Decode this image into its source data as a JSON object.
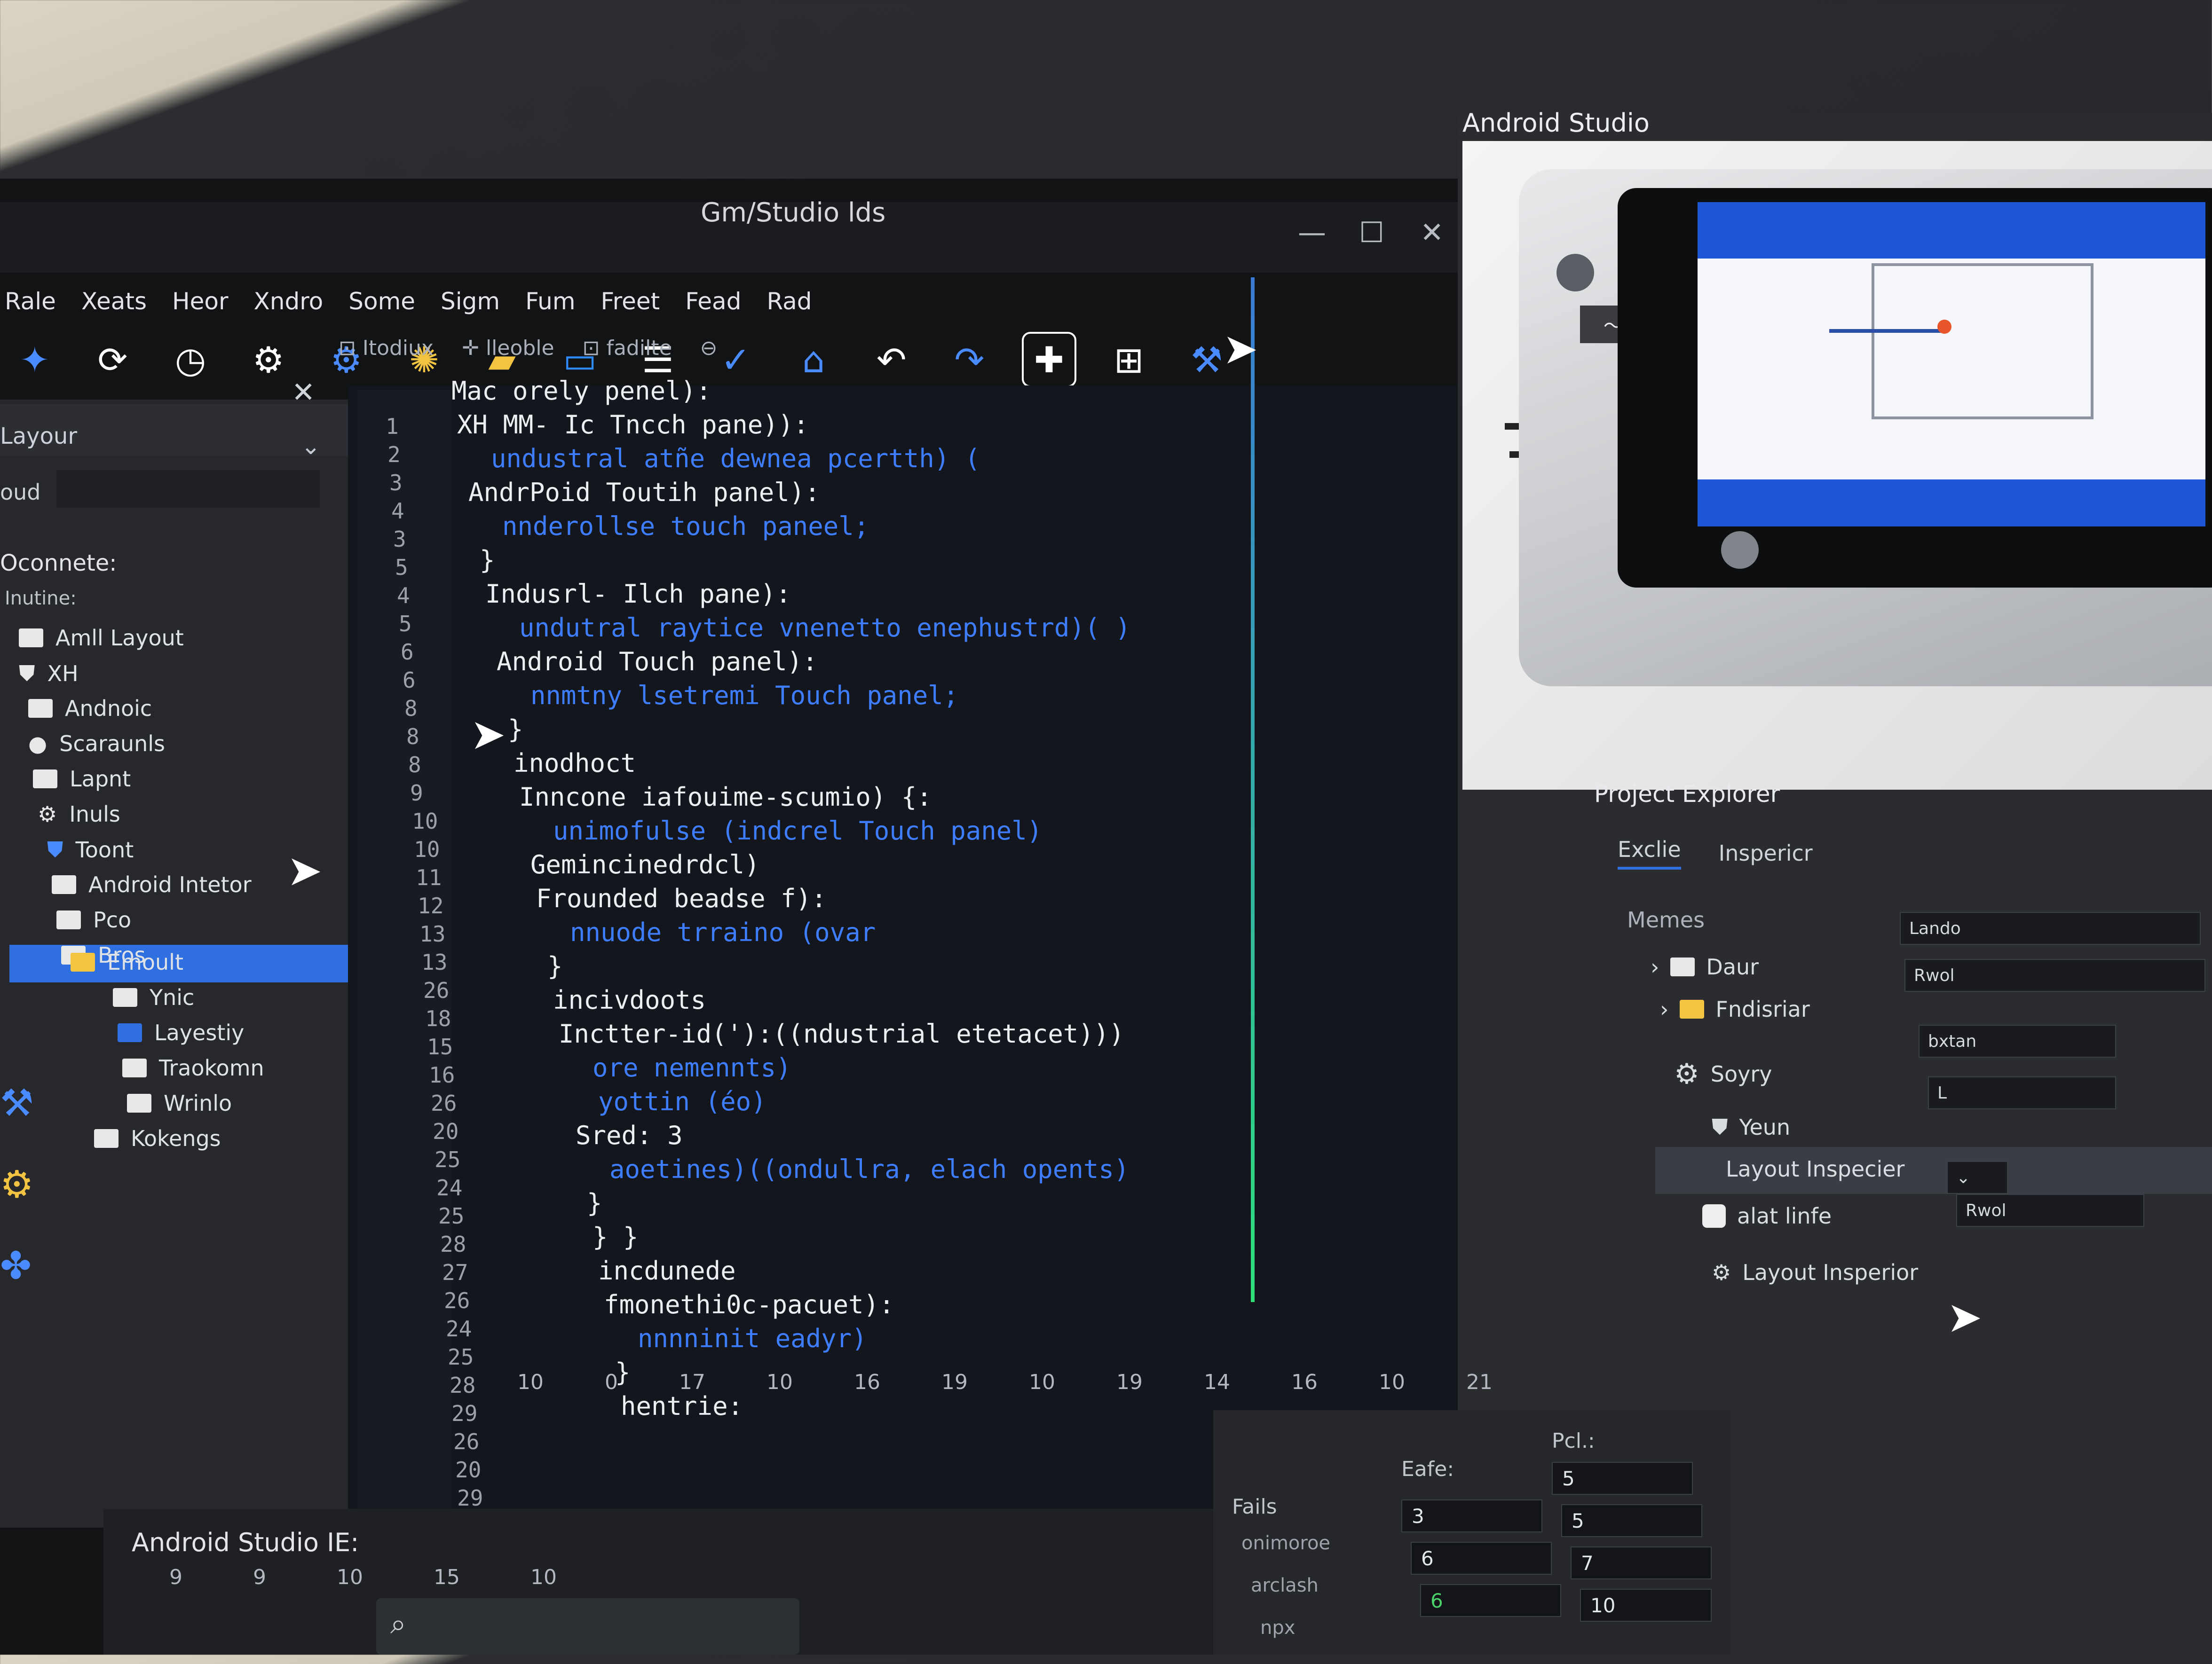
{
  "window": {
    "title": "Gm/Studio  lds",
    "controls": [
      "—",
      "☐",
      "✕"
    ]
  },
  "menu": [
    "Rale",
    "Xeats",
    "Heor",
    "Xndro",
    "Some",
    "Sigm",
    "Fum",
    "Freet",
    "Fead",
    "Rad"
  ],
  "toolbar_icons": [
    "pin-icon",
    "refresh-icon",
    "clock-icon",
    "settings-icon",
    "gear-icon",
    "sun-icon",
    "folder-icon",
    "folder-blue-icon",
    "list-icon",
    "check-icon",
    "house-icon",
    "undo-icon",
    "redo-icon",
    "add-icon",
    "build-icon",
    "tools-icon"
  ],
  "tabs": [
    "⊡ Itodiux",
    "✛ lleoble",
    "⊡ fadilte",
    "⊖"
  ],
  "left_panel": {
    "header": "Layour",
    "search_label": "oud",
    "section_title": "Oconnete:",
    "section_sub": "Inutine:",
    "items": [
      {
        "label": "Amll Layout",
        "icon": "folder"
      },
      {
        "label": "XH",
        "icon": "shield"
      },
      {
        "label": "Andnoic",
        "icon": "folder"
      },
      {
        "label": "Scaraunls",
        "icon": "circle"
      },
      {
        "label": "Lapnt",
        "icon": "folder"
      },
      {
        "label": "Inuls",
        "icon": "gear"
      },
      {
        "label": "Toont",
        "icon": "shield"
      },
      {
        "label": "Android Intetor",
        "icon": "folder"
      },
      {
        "label": "Pco",
        "icon": "folder"
      },
      {
        "label": "Bros",
        "icon": "folder"
      },
      {
        "label": "Emoult",
        "icon": "folder-yellow"
      },
      {
        "label": "Ynic",
        "icon": "folder"
      },
      {
        "label": "Layestiy",
        "icon": "folder-blue"
      },
      {
        "label": "Traokomn",
        "icon": "folder"
      },
      {
        "label": "Wrinlo",
        "icon": "folder"
      },
      {
        "label": "Kokengs",
        "icon": "folder"
      }
    ]
  },
  "editor": {
    "line_numbers": [
      "1",
      "2",
      "3",
      "4",
      "3",
      "5",
      "4",
      "5",
      "6",
      "6",
      "8",
      "8",
      "8",
      "9",
      "10",
      "10",
      "11",
      "12",
      "13",
      "13",
      "26",
      "18",
      "15",
      "16",
      "26",
      "20",
      "25",
      "24",
      "25",
      "28",
      "27",
      "26",
      "24",
      "25",
      "28",
      "29",
      "26",
      "20",
      "29"
    ],
    "lines": [
      {
        "text": "Mac orely penel):",
        "color": "white"
      },
      {
        "text": "XH MM- Ic Tncch pane)):",
        "color": "white"
      },
      {
        "text": "undustral atñe dewnea pcertth) (",
        "color": "blue"
      },
      {
        "text": "AndrPoid Toutih panel):",
        "color": "white"
      },
      {
        "text": "nnderollse touch paneel;",
        "color": "blue"
      },
      {
        "text": "}",
        "color": "white"
      },
      {
        "text": "Indusrl- Ilch pane):",
        "color": "white"
      },
      {
        "text": "undutral raytice vnenetto enephustrd)(   )",
        "color": "blue"
      },
      {
        "text": "Android Touch panel):",
        "color": "white"
      },
      {
        "text": "nnmtny lsetremi Touch panel;",
        "color": "blue"
      },
      {
        "text": "}",
        "color": "white"
      },
      {
        "text": "inodhoct",
        "color": "white"
      },
      {
        "text": "Inncone iafouime-scumio)  {:",
        "color": "white"
      },
      {
        "text": "unimofulse (indcrel Touch panel)",
        "color": "blue"
      },
      {
        "text": "Gemincinedrdcl)",
        "color": "white"
      },
      {
        "text": "Frounded beadse f):",
        "color": "white"
      },
      {
        "text": "nnuode trraino (ovar",
        "color": "blue"
      },
      {
        "text": "}",
        "color": "white"
      },
      {
        "text": "incivdoots",
        "color": "white"
      },
      {
        "text": "Inctter-id('):((ndustrial etetacet)))",
        "color": "white"
      },
      {
        "text": "ore nemennts)",
        "color": "blue"
      },
      {
        "text": "yottin (éo)",
        "color": "blue"
      },
      {
        "text": "Sred: 3",
        "color": "white"
      },
      {
        "text": "aoetines)((ondullra, elach opents)",
        "color": "blue"
      },
      {
        "text": "}",
        "color": "white"
      },
      {
        "text": "}  }",
        "color": "white"
      },
      {
        "text": "incdunede",
        "color": "white"
      },
      {
        "text": "fmonethi0c-pacuet):",
        "color": "white"
      },
      {
        "text": "nnnninit eadyr)",
        "color": "blue"
      },
      {
        "text": "}",
        "color": "white"
      },
      {
        "text": "hentrie:",
        "color": "white"
      }
    ]
  },
  "right_panel": {
    "title": "Android  Studio",
    "explorer_title": "Project  Explorer",
    "tabs": [
      "Exclie",
      "Inspericr"
    ],
    "section": "Memes",
    "rows": [
      {
        "label": "Daur",
        "icon": "folder",
        "value": "Lando"
      },
      {
        "label": "Fndisriar",
        "icon": "folder-yellow",
        "value": "Rwol"
      },
      {
        "label": "Soyry",
        "icon": "gear",
        "value": "bxtan"
      },
      {
        "label": "Yeun",
        "icon": "shield",
        "value": "L"
      },
      {
        "label": "Layout Inspecier",
        "icon": "",
        "value": ""
      },
      {
        "label": "alat linfe",
        "icon": "toggle",
        "value": "Rwol"
      },
      {
        "label": "Layout Insperior",
        "icon": "gear",
        "value": ""
      }
    ]
  },
  "bottom": {
    "label": "Android Studio IE:",
    "ruler": [
      "10",
      "0",
      "17",
      "10",
      "16",
      "19",
      "10",
      "19",
      "14",
      "16",
      "10",
      "21"
    ],
    "ruler2": [
      "9",
      "9",
      "10",
      "15",
      "10"
    ]
  },
  "table": {
    "header_left": "Fails",
    "header_mid": "Eafe:",
    "header_right": "Pcl.:",
    "left_items": [
      "onimoroe",
      "arclash",
      "npx"
    ],
    "col1": [
      "3",
      "6",
      "6"
    ],
    "col2": [
      "5",
      "5",
      "7",
      "10"
    ]
  },
  "colors": {
    "accent": "#2f6fe0",
    "code_blue": "#3f7dff",
    "panel": "#26282c",
    "editor": "#13161c"
  }
}
